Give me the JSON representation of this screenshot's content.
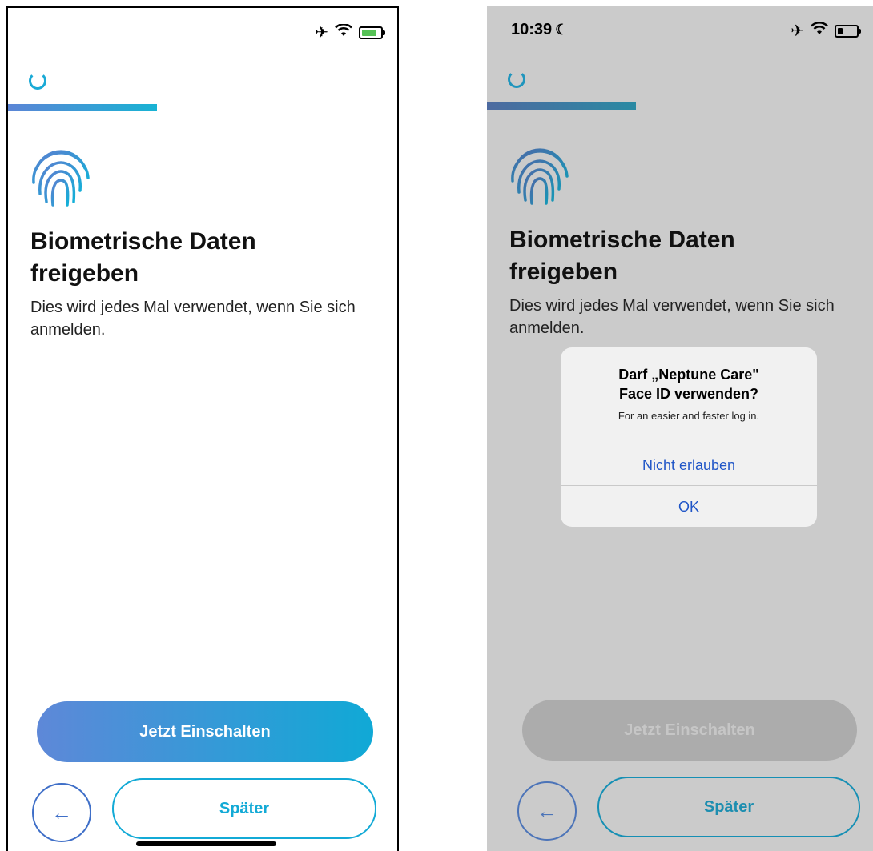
{
  "left_screen": {
    "status_bar": {
      "icons": [
        "airplane-icon",
        "wifi-icon",
        "battery-charging-icon"
      ]
    },
    "headline_line1": "Biometrische Daten",
    "headline_line2": "freigeben",
    "description": "Dies wird jedes Mal verwendet, wenn Sie sich anmelden.",
    "primary_button": "Jetzt Einschalten",
    "back_button": "←",
    "later_button": "Später"
  },
  "right_screen": {
    "status_bar": {
      "time": "10:39",
      "moon": "☾",
      "icons": [
        "airplane-icon",
        "wifi-icon",
        "battery-icon"
      ]
    },
    "headline_line1": "Biometrische Daten",
    "headline_line2": "freigeben",
    "description": "Dies wird jedes Mal verwendet, wenn Sie sich anmelden.",
    "primary_button": "Jetzt Einschalten",
    "back_button": "←",
    "later_button": "Später",
    "dialog": {
      "title_line1": "Darf „Neptune Care\"",
      "title_line2": "Face ID verwenden?",
      "message": "For an easier and faster log in.",
      "deny_button": "Nicht erlauben",
      "ok_button": "OK"
    }
  },
  "colors": {
    "accent_blue": "#13aad6",
    "gradient_start": "#5e88d8",
    "dialog_link": "#1f55c7",
    "dim_overlay": "#cbcbcb"
  }
}
